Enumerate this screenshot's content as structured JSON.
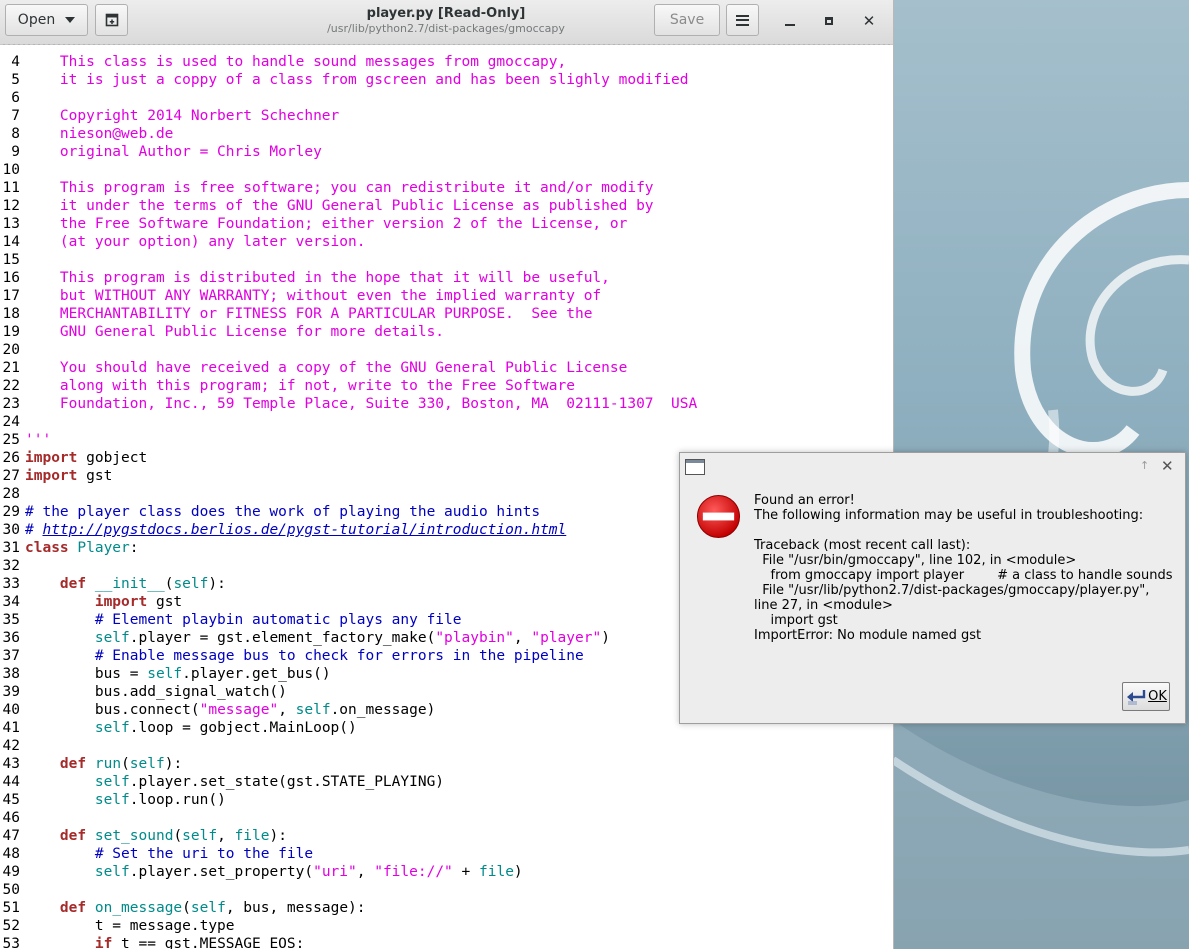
{
  "window": {
    "title": "player.py [Read-Only]",
    "subtitle": "/usr/lib/python2.7/dist-packages/gmoccapy",
    "open_label": "Open",
    "save_label": "Save"
  },
  "code_lines": [
    {
      "n": "4",
      "segs": [
        {
          "t": "    This class is used to handle sound messages from gmoccapy,",
          "c": "str"
        }
      ]
    },
    {
      "n": "5",
      "segs": [
        {
          "t": "    it is just a coppy of a class from gscreen and has been slighly modified",
          "c": "str"
        }
      ]
    },
    {
      "n": "6",
      "segs": []
    },
    {
      "n": "7",
      "segs": [
        {
          "t": "    Copyright 2014 Norbert Schechner",
          "c": "str"
        }
      ]
    },
    {
      "n": "8",
      "segs": [
        {
          "t": "    nieson@web.de",
          "c": "str"
        }
      ]
    },
    {
      "n": "9",
      "segs": [
        {
          "t": "    original Author = Chris Morley",
          "c": "str"
        }
      ]
    },
    {
      "n": "10",
      "segs": []
    },
    {
      "n": "11",
      "segs": [
        {
          "t": "    This program is free software; you can redistribute it and/or modify",
          "c": "str"
        }
      ]
    },
    {
      "n": "12",
      "segs": [
        {
          "t": "    it under the terms of the GNU General Public License as published by",
          "c": "str"
        }
      ]
    },
    {
      "n": "13",
      "segs": [
        {
          "t": "    the Free Software Foundation; either version 2 of the License, or",
          "c": "str"
        }
      ]
    },
    {
      "n": "14",
      "segs": [
        {
          "t": "    (at your option) any later version.",
          "c": "str"
        }
      ]
    },
    {
      "n": "15",
      "segs": []
    },
    {
      "n": "16",
      "segs": [
        {
          "t": "    This program is distributed in the hope that it will be useful,",
          "c": "str"
        }
      ]
    },
    {
      "n": "17",
      "segs": [
        {
          "t": "    but WITHOUT ANY WARRANTY; without even the implied warranty of",
          "c": "str"
        }
      ]
    },
    {
      "n": "18",
      "segs": [
        {
          "t": "    MERCHANTABILITY or FITNESS FOR A PARTICULAR PURPOSE.  See the",
          "c": "str"
        }
      ]
    },
    {
      "n": "19",
      "segs": [
        {
          "t": "    GNU General Public License for more details.",
          "c": "str"
        }
      ]
    },
    {
      "n": "20",
      "segs": []
    },
    {
      "n": "21",
      "segs": [
        {
          "t": "    You should have received a copy of the GNU General Public License",
          "c": "str"
        }
      ]
    },
    {
      "n": "22",
      "segs": [
        {
          "t": "    along with this program; if not, write to the Free Software",
          "c": "str"
        }
      ]
    },
    {
      "n": "23",
      "segs": [
        {
          "t": "    Foundation, Inc., 59 Temple Place, Suite 330, Boston, MA  02111-1307  USA",
          "c": "str"
        }
      ]
    },
    {
      "n": "24",
      "segs": []
    },
    {
      "n": "25",
      "segs": [
        {
          "t": "'''",
          "c": "str"
        }
      ]
    },
    {
      "n": "26",
      "segs": [
        {
          "t": "import",
          "c": "kw"
        },
        {
          "t": " gobject",
          "c": ""
        }
      ]
    },
    {
      "n": "27",
      "segs": [
        {
          "t": "import",
          "c": "kw"
        },
        {
          "t": " gst",
          "c": ""
        }
      ]
    },
    {
      "n": "28",
      "segs": []
    },
    {
      "n": "29",
      "segs": [
        {
          "t": "# the player class does the work of playing the audio hints",
          "c": "cm"
        }
      ]
    },
    {
      "n": "30",
      "segs": [
        {
          "t": "# ",
          "c": "cm"
        },
        {
          "t": "http://pygstdocs.berlios.de/pygst-tutorial/introduction.html",
          "c": "link"
        }
      ]
    },
    {
      "n": "31",
      "segs": [
        {
          "t": "class",
          "c": "kw"
        },
        {
          "t": " ",
          "c": ""
        },
        {
          "t": "Player",
          "c": "fn"
        },
        {
          "t": ":",
          "c": ""
        }
      ]
    },
    {
      "n": "32",
      "segs": []
    },
    {
      "n": "33",
      "segs": [
        {
          "t": "    ",
          "c": ""
        },
        {
          "t": "def",
          "c": "kw"
        },
        {
          "t": " ",
          "c": ""
        },
        {
          "t": "__init__",
          "c": "fn"
        },
        {
          "t": "(",
          "c": ""
        },
        {
          "t": "self",
          "c": "self"
        },
        {
          "t": "):",
          "c": ""
        }
      ]
    },
    {
      "n": "34",
      "segs": [
        {
          "t": "        ",
          "c": ""
        },
        {
          "t": "import",
          "c": "kw"
        },
        {
          "t": " gst",
          "c": ""
        }
      ]
    },
    {
      "n": "35",
      "segs": [
        {
          "t": "        # Element playbin automatic plays any file",
          "c": "cm"
        }
      ]
    },
    {
      "n": "36",
      "segs": [
        {
          "t": "        ",
          "c": ""
        },
        {
          "t": "self",
          "c": "self"
        },
        {
          "t": ".player = gst.element_factory_make(",
          "c": ""
        },
        {
          "t": "\"playbin\"",
          "c": "dstr"
        },
        {
          "t": ", ",
          "c": ""
        },
        {
          "t": "\"player\"",
          "c": "dstr"
        },
        {
          "t": ")",
          "c": ""
        }
      ]
    },
    {
      "n": "37",
      "segs": [
        {
          "t": "        # Enable message bus to check for errors in the pipeline",
          "c": "cm"
        }
      ]
    },
    {
      "n": "38",
      "segs": [
        {
          "t": "        bus = ",
          "c": ""
        },
        {
          "t": "self",
          "c": "self"
        },
        {
          "t": ".player.get_bus()",
          "c": ""
        }
      ]
    },
    {
      "n": "39",
      "segs": [
        {
          "t": "        bus.add_signal_watch()",
          "c": ""
        }
      ]
    },
    {
      "n": "40",
      "segs": [
        {
          "t": "        bus.connect(",
          "c": ""
        },
        {
          "t": "\"message\"",
          "c": "dstr"
        },
        {
          "t": ", ",
          "c": ""
        },
        {
          "t": "self",
          "c": "self"
        },
        {
          "t": ".on_message)",
          "c": ""
        }
      ]
    },
    {
      "n": "41",
      "segs": [
        {
          "t": "        ",
          "c": ""
        },
        {
          "t": "self",
          "c": "self"
        },
        {
          "t": ".loop = gobject.MainLoop()",
          "c": ""
        }
      ]
    },
    {
      "n": "42",
      "segs": []
    },
    {
      "n": "43",
      "segs": [
        {
          "t": "    ",
          "c": ""
        },
        {
          "t": "def",
          "c": "kw"
        },
        {
          "t": " ",
          "c": ""
        },
        {
          "t": "run",
          "c": "fn"
        },
        {
          "t": "(",
          "c": ""
        },
        {
          "t": "self",
          "c": "self"
        },
        {
          "t": "):",
          "c": ""
        }
      ]
    },
    {
      "n": "44",
      "segs": [
        {
          "t": "        ",
          "c": ""
        },
        {
          "t": "self",
          "c": "self"
        },
        {
          "t": ".player.set_state(gst.STATE_PLAYING)",
          "c": ""
        }
      ]
    },
    {
      "n": "45",
      "segs": [
        {
          "t": "        ",
          "c": ""
        },
        {
          "t": "self",
          "c": "self"
        },
        {
          "t": ".loop.run()",
          "c": ""
        }
      ]
    },
    {
      "n": "46",
      "segs": []
    },
    {
      "n": "47",
      "segs": [
        {
          "t": "    ",
          "c": ""
        },
        {
          "t": "def",
          "c": "kw"
        },
        {
          "t": " ",
          "c": ""
        },
        {
          "t": "set_sound",
          "c": "fn"
        },
        {
          "t": "(",
          "c": ""
        },
        {
          "t": "self",
          "c": "self"
        },
        {
          "t": ", ",
          "c": ""
        },
        {
          "t": "file",
          "c": "self"
        },
        {
          "t": "):",
          "c": ""
        }
      ]
    },
    {
      "n": "48",
      "segs": [
        {
          "t": "        # Set the uri to the file",
          "c": "cm"
        }
      ]
    },
    {
      "n": "49",
      "segs": [
        {
          "t": "        ",
          "c": ""
        },
        {
          "t": "self",
          "c": "self"
        },
        {
          "t": ".player.set_property(",
          "c": ""
        },
        {
          "t": "\"uri\"",
          "c": "dstr"
        },
        {
          "t": ", ",
          "c": ""
        },
        {
          "t": "\"file://\"",
          "c": "dstr"
        },
        {
          "t": " + ",
          "c": ""
        },
        {
          "t": "file",
          "c": "self"
        },
        {
          "t": ")",
          "c": ""
        }
      ]
    },
    {
      "n": "50",
      "segs": []
    },
    {
      "n": "51",
      "segs": [
        {
          "t": "    ",
          "c": ""
        },
        {
          "t": "def",
          "c": "kw"
        },
        {
          "t": " ",
          "c": ""
        },
        {
          "t": "on_message",
          "c": "fn"
        },
        {
          "t": "(",
          "c": ""
        },
        {
          "t": "self",
          "c": "self"
        },
        {
          "t": ", bus, message):",
          "c": ""
        }
      ]
    },
    {
      "n": "52",
      "segs": [
        {
          "t": "        t = message.type",
          "c": ""
        }
      ]
    },
    {
      "n": "53",
      "segs": [
        {
          "t": "        ",
          "c": ""
        },
        {
          "t": "if",
          "c": "kw"
        },
        {
          "t": " t == gst.MESSAGE_EOS:",
          "c": ""
        }
      ]
    }
  ],
  "dialog": {
    "lines": [
      "Found an error!",
      "The following information may be useful in troubleshooting:",
      "",
      "Traceback (most recent call last):",
      "  File \"/usr/bin/gmoccapy\", line 102, in <module>",
      "    from gmoccapy import player        # a class to handle sounds",
      "  File \"/usr/lib/python2.7/dist-packages/gmoccapy/player.py\",",
      "line 27, in <module>",
      "    import gst",
      "ImportError: No module named gst"
    ],
    "ok_label": "OK"
  },
  "colors": {
    "string": "#e100e1",
    "keyword": "#a52a2a",
    "comment": "#0000c0",
    "builtin": "#008a8a"
  }
}
